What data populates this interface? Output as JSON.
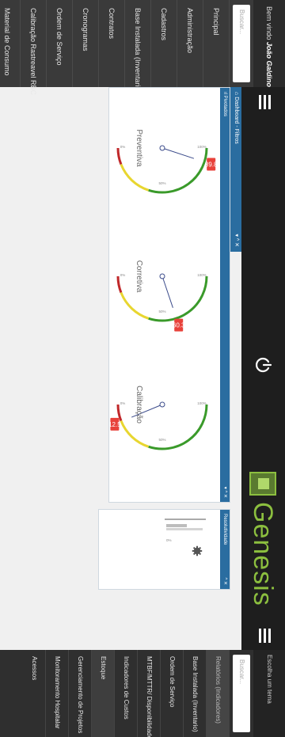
{
  "left_nav": {
    "welcome_prefix": "Bem vindo",
    "user_name": "João Galdino",
    "search_placeholder": "Buscar...",
    "items": [
      {
        "label": "Principal"
      },
      {
        "label": "Administração"
      },
      {
        "label": "Cadastros"
      },
      {
        "label": "Base Instalada (Inventario)"
      },
      {
        "label": "Contratos"
      },
      {
        "label": "Cronogramas"
      },
      {
        "label": "Ordem de Serviço"
      },
      {
        "label": "Calibração Rastreavel RBC"
      },
      {
        "label": "Material de Consumo"
      }
    ]
  },
  "header": {
    "logo_text": "Genesis"
  },
  "breadcrumb": {
    "label": "Dashboard - Filtros",
    "controls": "▾ ^ ✕"
  },
  "panel_gauges": {
    "title": "Pivotados",
    "controls": "▾ ^ ✕",
    "gauges": [
      {
        "label": "Preventiva",
        "value": 89.8,
        "value_text": "89.8"
      },
      {
        "label": "Corretiva",
        "value": 60.3,
        "value_text": "60.3"
      },
      {
        "label": "Calibração",
        "value": 12.5,
        "value_text": "12.5"
      }
    ],
    "ticks": [
      "0%",
      "50%",
      "100%"
    ]
  },
  "panel_resolutividade": {
    "title": "Resolutividade",
    "controls": "^ ✕",
    "axis_label": "0%"
  },
  "right_nav": {
    "theme_label": "Escolha um tema",
    "search_placeholder": "Buscar...",
    "items": [
      {
        "label": "Relatórios (Indicadores)",
        "type": "head"
      },
      {
        "label": "Base Instalada (Inventario)"
      },
      {
        "label": "Ordem de Serviço"
      },
      {
        "label": "MTBF/MTTR/ Disponibilidade"
      },
      {
        "label": "Indicadores de Custos"
      },
      {
        "label": "Estoque"
      },
      {
        "label": "Gerenciamento de Projetos"
      },
      {
        "label": "Monitoramento Hospitalar"
      },
      {
        "label": "Acessos"
      }
    ]
  },
  "colors": {
    "accent_blue": "#2a6da0",
    "brand_green": "#8cbf3f",
    "gauge_green": "#3a9a2a",
    "gauge_yellow": "#e8d630",
    "gauge_red": "#c0282a"
  }
}
